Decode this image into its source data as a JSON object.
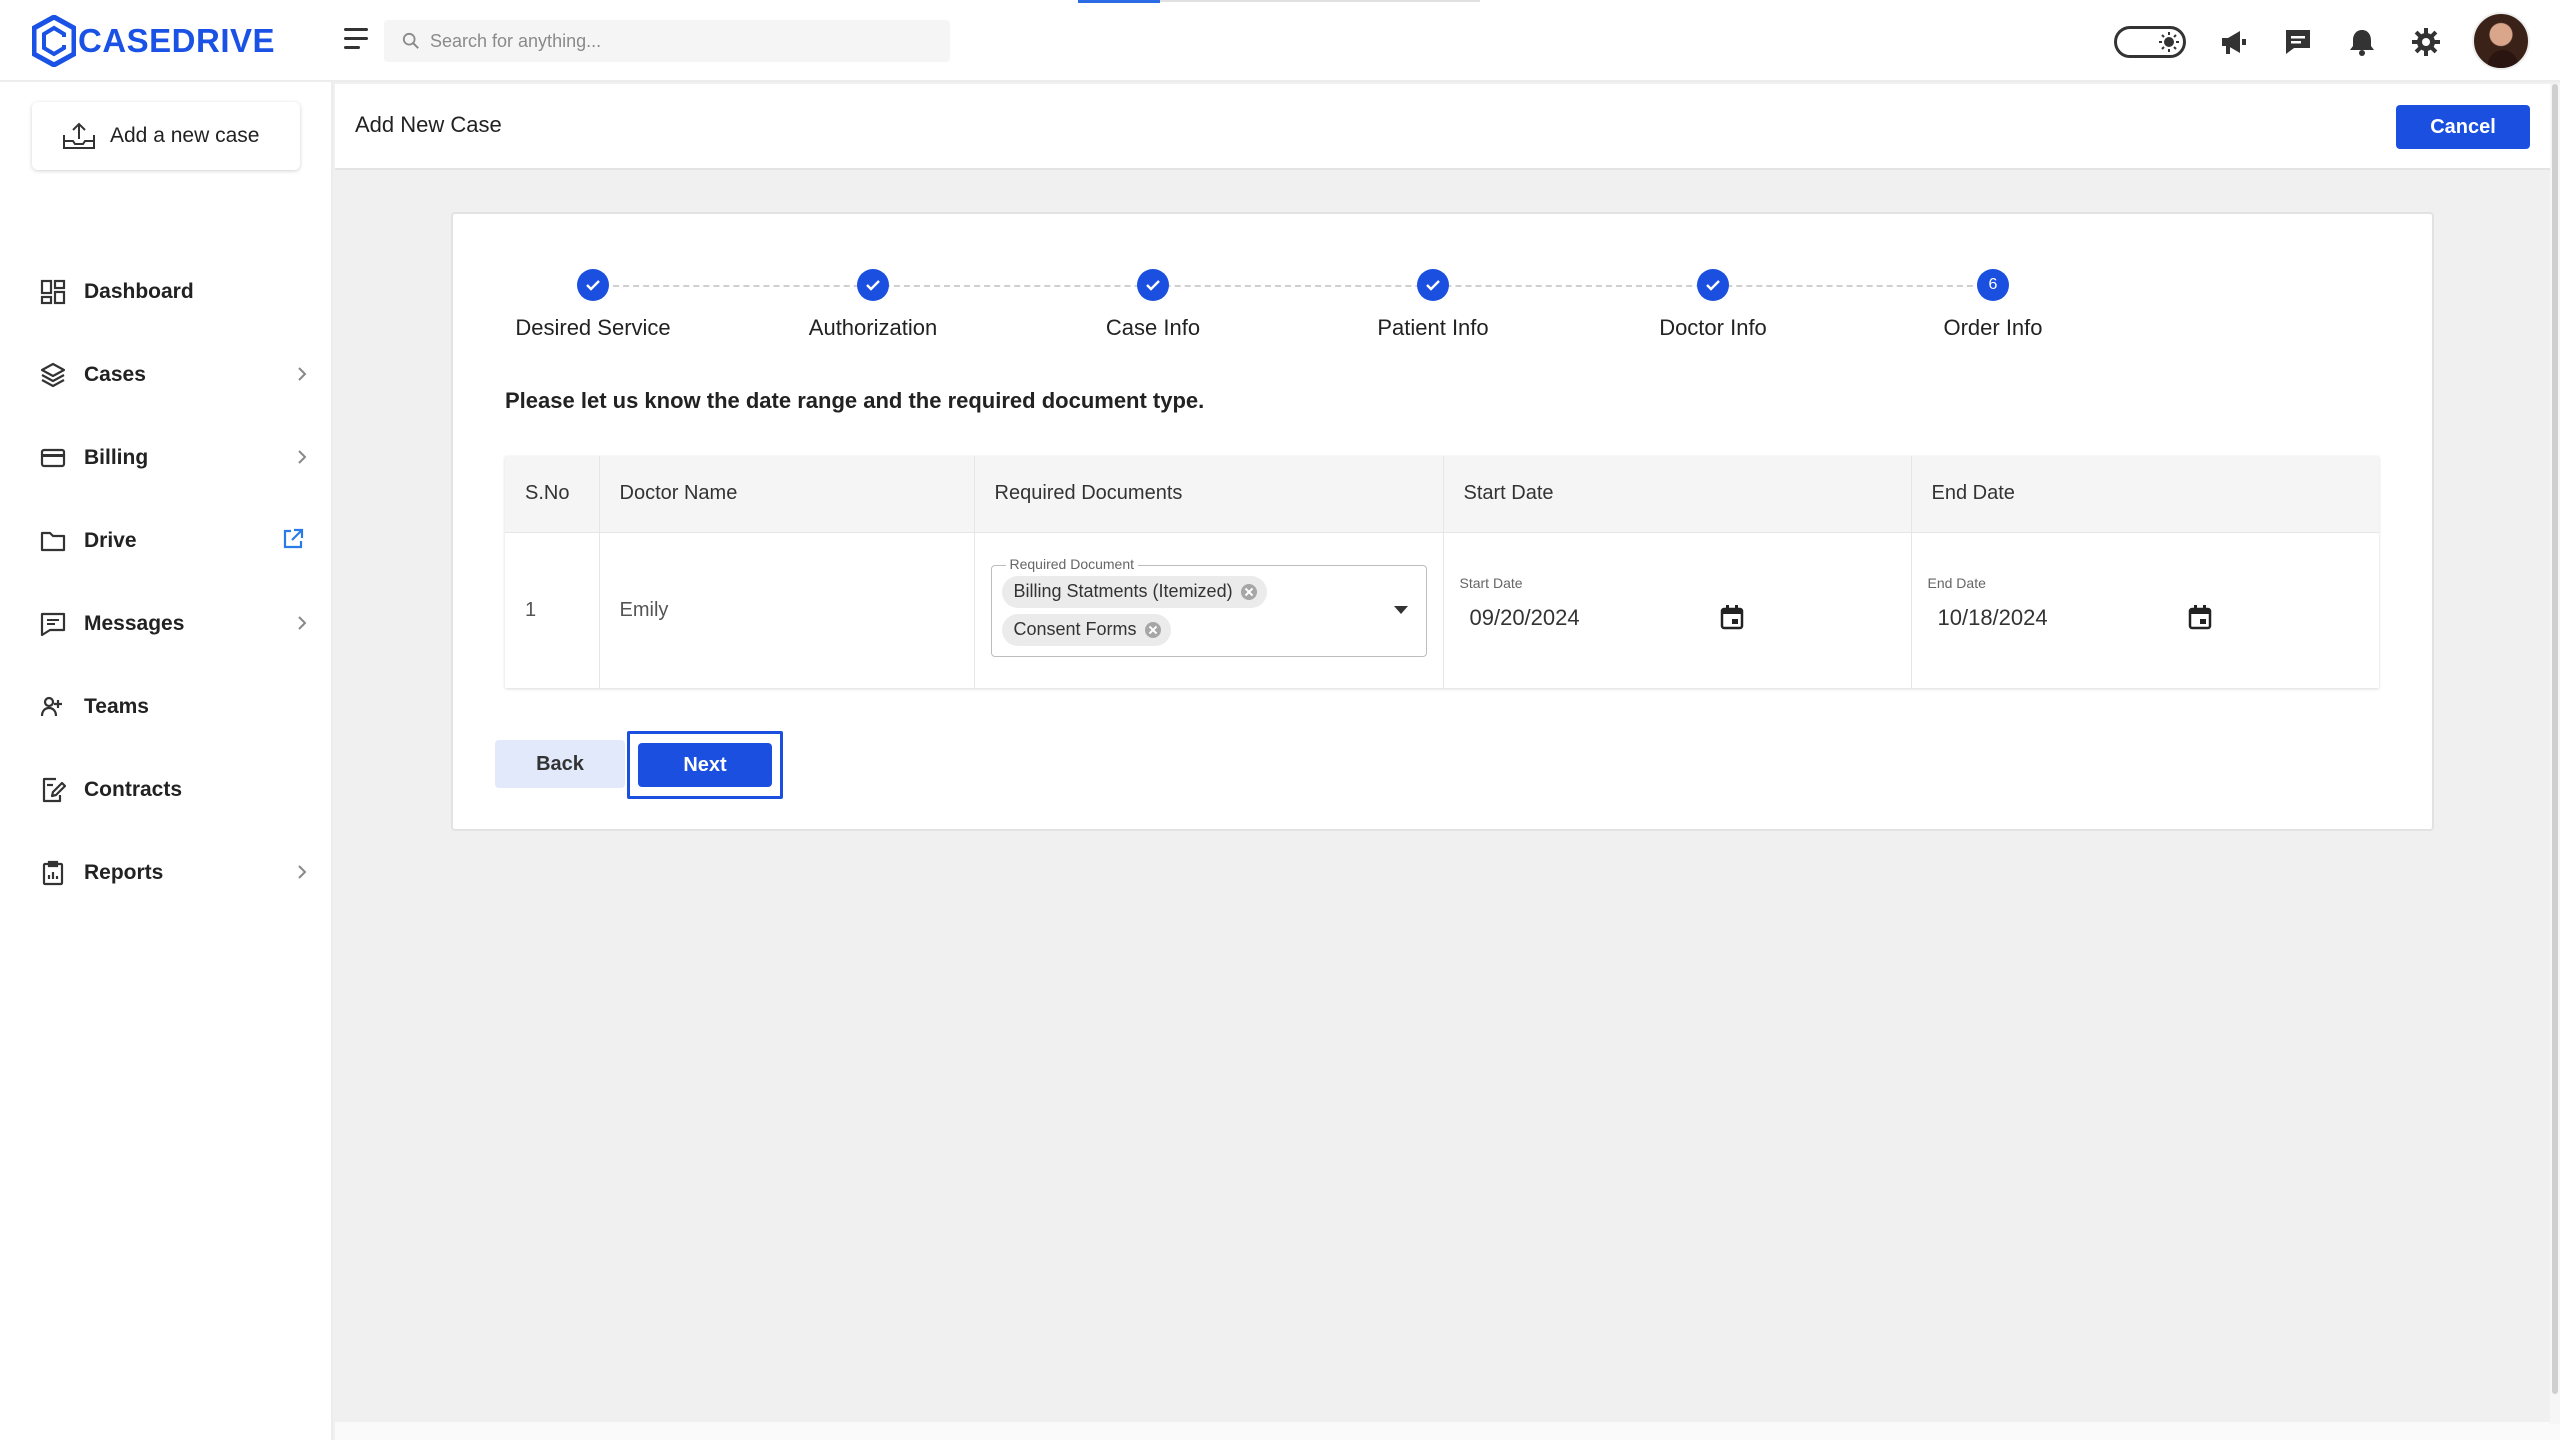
{
  "brand": {
    "name": "CASEDRIVE",
    "color": "#1a52e6"
  },
  "search": {
    "placeholder": "Search for anything..."
  },
  "topbar_icons": [
    "theme-toggle-icon",
    "megaphone-icon",
    "chat-icon",
    "bell-icon",
    "gear-icon",
    "avatar"
  ],
  "sidebar": {
    "add_case_label": "Add a new case",
    "items": [
      {
        "label": "Dashboard",
        "icon": "dashboard-icon",
        "has_chevron": false
      },
      {
        "label": "Cases",
        "icon": "layers-icon",
        "has_chevron": true
      },
      {
        "label": "Billing",
        "icon": "card-icon",
        "has_chevron": true
      },
      {
        "label": "Drive",
        "icon": "folder-icon",
        "has_external": true
      },
      {
        "label": "Messages",
        "icon": "message-icon",
        "has_chevron": true
      },
      {
        "label": "Teams",
        "icon": "team-icon",
        "has_chevron": false
      },
      {
        "label": "Contracts",
        "icon": "contract-icon",
        "has_chevron": false
      },
      {
        "label": "Reports",
        "icon": "report-icon",
        "has_chevron": true
      }
    ]
  },
  "header": {
    "title": "Add New Case",
    "cancel_label": "Cancel"
  },
  "stepper": {
    "steps": [
      {
        "label": "Desired Service",
        "status": "done"
      },
      {
        "label": "Authorization",
        "status": "done"
      },
      {
        "label": "Case Info",
        "status": "done"
      },
      {
        "label": "Patient Info",
        "status": "done"
      },
      {
        "label": "Doctor Info",
        "status": "done"
      },
      {
        "label": "Order Info",
        "status": "current",
        "number": "6"
      }
    ],
    "accent": "#1a4fe0"
  },
  "instruction": "Please let us know the date range and the required document type.",
  "table": {
    "headers": [
      "S.No",
      "Doctor Name",
      "Required Documents",
      "Start Date",
      "End Date"
    ],
    "rows": [
      {
        "sno": "1",
        "doctor": "Emily",
        "required_label": "Required Document",
        "documents": [
          "Billing Statments (Itemized)",
          "Consent Forms"
        ],
        "start_label": "Start Date",
        "start_date": "09/20/2024",
        "end_label": "End Date",
        "end_date": "10/18/2024"
      }
    ]
  },
  "actions": {
    "back_label": "Back",
    "next_label": "Next"
  }
}
